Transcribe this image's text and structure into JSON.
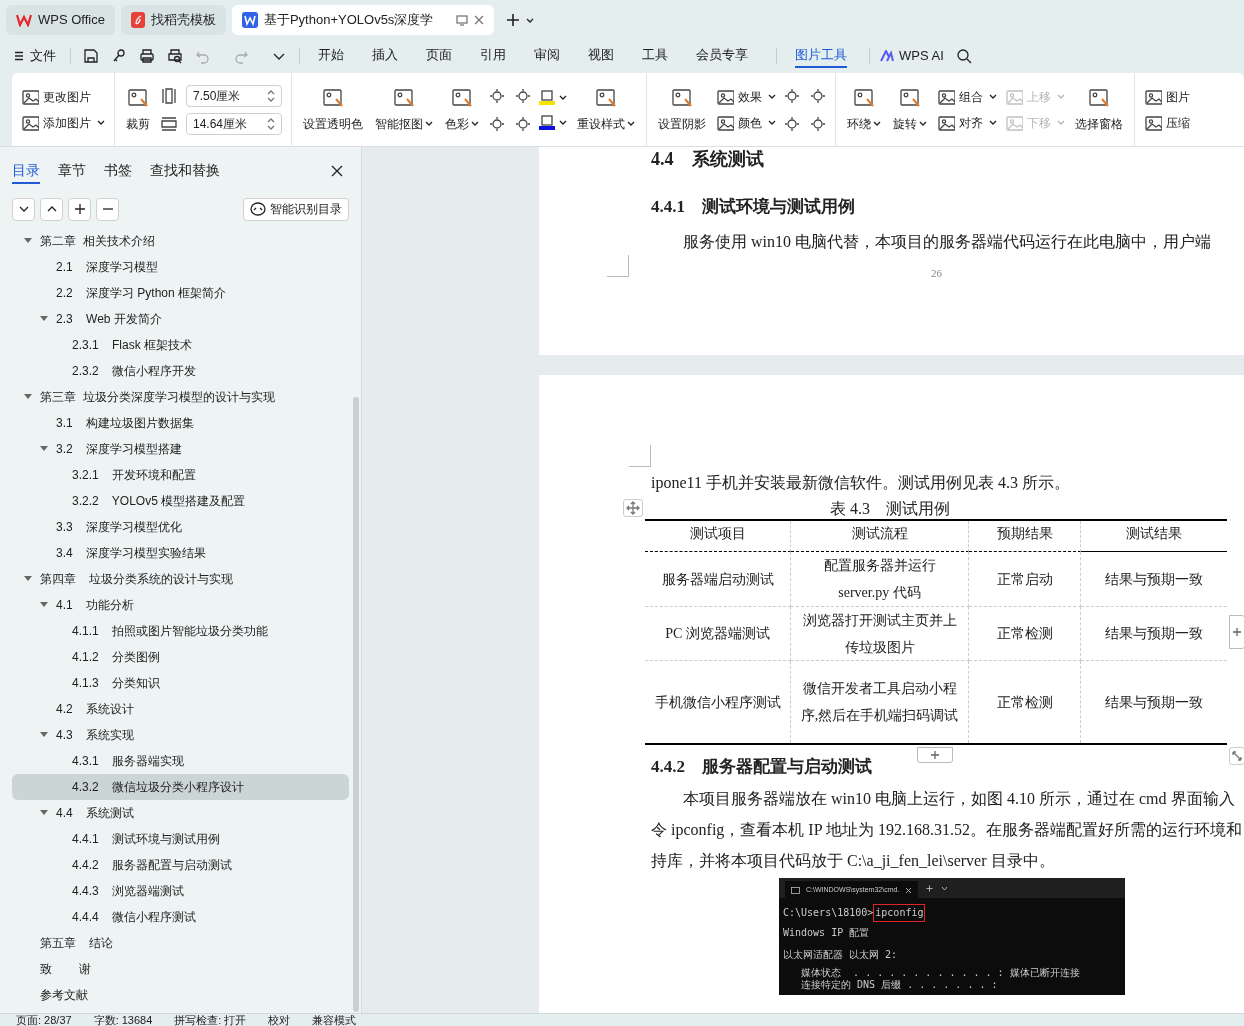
{
  "tabs": [
    {
      "label": "WPS Office",
      "kind": "wps",
      "selected": false
    },
    {
      "label": "找稻壳模板",
      "kind": "docer",
      "selected": false
    },
    {
      "label": "基于Python+YOLOv5s深度学",
      "kind": "doc",
      "selected": true
    }
  ],
  "menu": {
    "file": "文件",
    "tabs": [
      {
        "label": "开始",
        "selected": false
      },
      {
        "label": "插入",
        "selected": false
      },
      {
        "label": "页面",
        "selected": false
      },
      {
        "label": "引用",
        "selected": false
      },
      {
        "label": "审阅",
        "selected": false
      },
      {
        "label": "视图",
        "selected": false
      },
      {
        "label": "工具",
        "selected": false
      },
      {
        "label": "会员专享",
        "selected": false
      },
      {
        "label": "图片工具",
        "selected": true
      }
    ],
    "ai": "WPS AI"
  },
  "ribbon": [
    [
      {
        "kind": "small",
        "items": [
          {
            "label": "更改图片",
            "dropdown": false,
            "disabled": false
          },
          {
            "label": "添加图片",
            "dropdown": true,
            "disabled": false
          }
        ]
      }
    ],
    [
      {
        "kind": "large",
        "label": "裁剪",
        "dropdown": false
      },
      {
        "kind": "size",
        "items": [
          "7.50厘米",
          "14.64厘米"
        ]
      }
    ],
    [
      {
        "kind": "large",
        "label": "设置透明色",
        "dropdown": false
      },
      {
        "kind": "large",
        "label": "智能抠图",
        "dropdown": true
      },
      {
        "kind": "large",
        "label": "色彩",
        "dropdown": true
      },
      {
        "kind": "icons",
        "items": [
          {
            "dropdown": false
          },
          {
            "dropdown": false
          },
          {
            "dropdown": false
          },
          {
            "dropdown": false
          }
        ]
      },
      {
        "kind": "swatches",
        "items": [
          {
            "color": "#f2e600",
            "dropdown": true
          },
          {
            "color": "#1010e0",
            "dropdown": true
          }
        ]
      },
      {
        "kind": "large",
        "label": "重设样式",
        "dropdown": true
      }
    ],
    [
      {
        "kind": "large",
        "label": "设置阴影",
        "dropdown": false
      },
      {
        "kind": "small",
        "items": [
          {
            "label": "效果",
            "dropdown": true,
            "disabled": false
          },
          {
            "label": "颜色",
            "dropdown": true,
            "disabled": false
          }
        ]
      },
      {
        "kind": "icons",
        "items": [
          {
            "dropdown": false
          },
          {
            "dropdown": false
          },
          {
            "dropdown": false
          },
          {
            "dropdown": false
          }
        ]
      }
    ],
    [
      {
        "kind": "large",
        "label": "环绕",
        "dropdown": true
      },
      {
        "kind": "large",
        "label": "旋转",
        "dropdown": true
      },
      {
        "kind": "small",
        "items": [
          {
            "label": "组合",
            "dropdown": true,
            "disabled": false
          },
          {
            "label": "对齐",
            "dropdown": true,
            "disabled": false
          }
        ]
      },
      {
        "kind": "small",
        "items": [
          {
            "label": "上移",
            "dropdown": true,
            "disabled": true
          },
          {
            "label": "下移",
            "dropdown": true,
            "disabled": true
          }
        ]
      },
      {
        "kind": "large",
        "label": "选择窗格",
        "dropdown": false
      }
    ],
    [
      {
        "kind": "small",
        "items": [
          {
            "label": "图片",
            "dropdown": false,
            "disabled": false
          },
          {
            "label": "压缩",
            "dropdown": false,
            "disabled": false
          }
        ]
      }
    ]
  ],
  "sidebar": {
    "tabs": [
      {
        "label": "目录",
        "selected": true
      },
      {
        "label": "章节",
        "selected": false
      },
      {
        "label": "书签",
        "selected": false
      },
      {
        "label": "查找和替换",
        "selected": false
      }
    ],
    "smart_button": "智能识别目录",
    "outline": [
      {
        "label": "第二章  相关技术介绍",
        "selected": false,
        "expanded": true,
        "children": [
          {
            "label": "2.1    深度学习模型",
            "selected": false
          },
          {
            "label": "2.2    深度学习 Python 框架简介",
            "selected": false
          },
          {
            "label": "2.3    Web 开发简介",
            "selected": false,
            "expanded": true,
            "children": [
              {
                "label": "2.3.1    Flask 框架技术",
                "selected": false
              },
              {
                "label": "2.3.2    微信小程序开发",
                "selected": false
              }
            ]
          }
        ]
      },
      {
        "label": "第三章  垃圾分类深度学习模型的设计与实现",
        "selected": false,
        "expanded": true,
        "children": [
          {
            "label": "3.1    构建垃圾图片数据集",
            "selected": false
          },
          {
            "label": "3.2    深度学习模型搭建",
            "selected": false,
            "expanded": true,
            "children": [
              {
                "label": "3.2.1    开发环境和配置",
                "selected": false
              },
              {
                "label": "3.2.2    YOLOv5 模型搭建及配置",
                "selected": false
              }
            ]
          },
          {
            "label": "3.3    深度学习模型优化",
            "selected": false
          },
          {
            "label": "3.4    深度学习模型实验结果",
            "selected": false
          }
        ]
      },
      {
        "label": "第四章    垃圾分类系统的设计与实现",
        "selected": false,
        "expanded": true,
        "children": [
          {
            "label": "4.1    功能分析",
            "selected": false,
            "expanded": true,
            "children": [
              {
                "label": "4.1.1    拍照或图片智能垃圾分类功能",
                "selected": false
              },
              {
                "label": "4.1.2    分类图例",
                "selected": false
              },
              {
                "label": "4.1.3    分类知识",
                "selected": false
              }
            ]
          },
          {
            "label": "4.2    系统设计",
            "selected": false
          },
          {
            "label": "4.3    系统实现",
            "selected": false,
            "expanded": true,
            "children": [
              {
                "label": "4.3.1    服务器端实现",
                "selected": false
              },
              {
                "label": "4.3.2    微信垃圾分类小程序设计",
                "selected": true
              }
            ]
          },
          {
            "label": "4.4    系统测试",
            "selected": false,
            "expanded": true,
            "children": [
              {
                "label": "4.4.1    测试环境与测试用例",
                "selected": false
              },
              {
                "label": "4.4.2    服务器配置与启动测试",
                "selected": false
              },
              {
                "label": "4.4.3    浏览器端测试",
                "selected": false
              },
              {
                "label": "4.4.4    微信小程序测试",
                "selected": false
              }
            ]
          }
        ]
      },
      {
        "label": "第五章    结论",
        "selected": false
      },
      {
        "label": "致        谢",
        "selected": false
      },
      {
        "label": "参考文献",
        "selected": false
      }
    ]
  },
  "page_1": {
    "heading": "4.4　系统测试",
    "subheading": "4.4.1　测试环境与测试用例",
    "paragraph": "服务使用 win10 电脑代替，本项目的服务器端代码运行在此电脑中，用户端",
    "page_number": "26"
  },
  "page_2": {
    "paragraph": "ipone11 手机并安装最新微信软件。测试用例见表 4.3 所示。",
    "caption": "表 4.3　测试用例",
    "table": {
      "columns": [
        "测试项目",
        "测试流程",
        "预期结果",
        "测试结果"
      ],
      "rows": [
        [
          [
            "服务器端启动测试"
          ],
          [
            "配置服务器并运行",
            "server.py 代码"
          ],
          [
            "正常启动"
          ],
          [
            "结果与预期一致"
          ]
        ],
        [
          [
            "PC 浏览器端测试"
          ],
          [
            "浏览器打开测试主页并上",
            "传垃圾图片"
          ],
          [
            "正常检测"
          ],
          [
            "结果与预期一致"
          ]
        ],
        [
          [
            "手机微信小程序测试"
          ],
          [
            "微信开发者工具启动小程",
            "序,然后在手机端扫码调试"
          ],
          [
            "正常检测"
          ],
          [
            "结果与预期一致"
          ]
        ]
      ]
    },
    "subheading": "4.4.2　服务器配置与启动测试",
    "lines": [
      "本项目服务器端放在 win10 电脑上运行，如图 4.10 所示，通过在 cmd 界面输入",
      "令 ipconfig，查看本机 IP 地址为 192.168.31.52。在服务器端配置好所需的运行环境和",
      "持库，并将本项目代码放于 C:\\a_ji_fen_lei\\server 目录中。"
    ],
    "terminal": {
      "tab": "C:\\WINDOWS\\system32\\cmd.",
      "prompt": "C:\\Users\\18100>",
      "command": "ipconfig",
      "lines": [
        "Windows IP 配置",
        "以太网适配器 以太网 2:",
        "   媒体状态  . . . . . . . . . . . . : 媒体已断开连接",
        "   连接特定的 DNS 后缀 . . . . . . . :"
      ]
    }
  },
  "status_bar": [
    "页面: 28/37",
    "字数: 13684",
    "拼写检查: 打开",
    "校对",
    "兼容模式"
  ]
}
